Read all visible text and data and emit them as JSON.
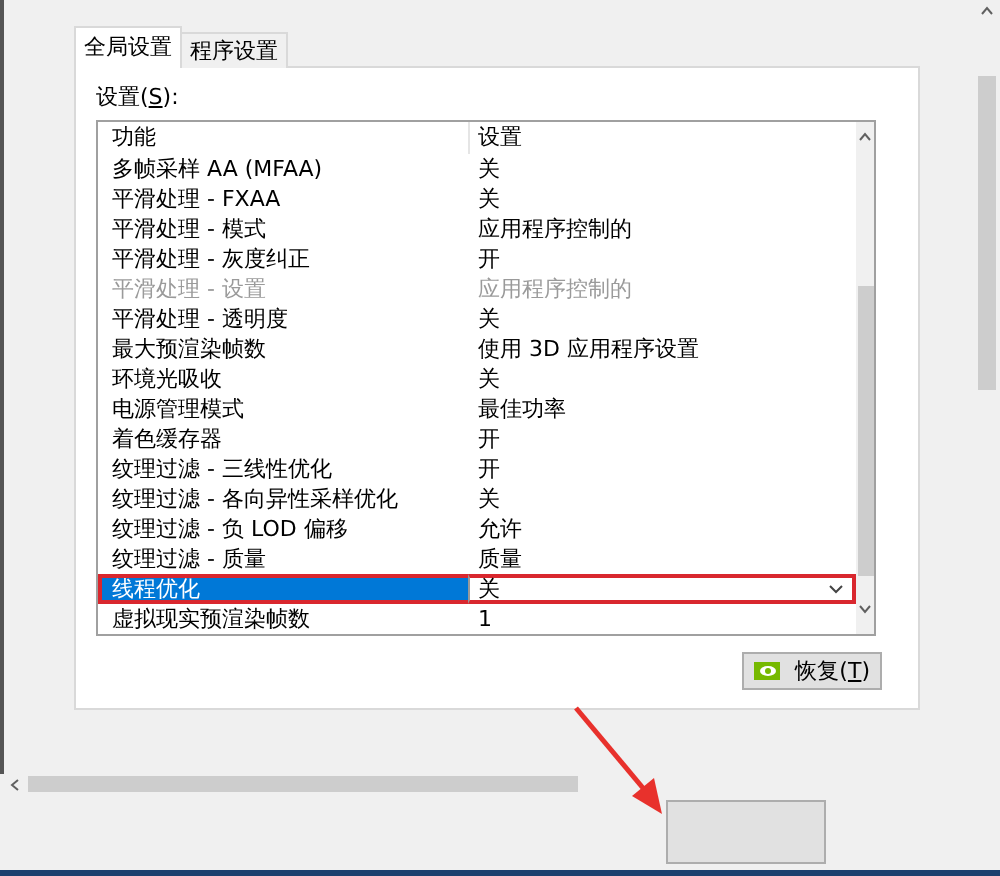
{
  "tabs": [
    {
      "label": "全局设置",
      "selected": true
    },
    {
      "label": "程序设置",
      "selected": false
    }
  ],
  "settings_label": {
    "before": "设置(",
    "mnemonic": "S",
    "after": "):"
  },
  "table": {
    "columns": [
      "功能",
      "设置"
    ],
    "rows": [
      {
        "feature": "多帧采样 AA (MFAA)",
        "value": "关",
        "disabled": false,
        "selected": false,
        "highlighted": false
      },
      {
        "feature": "平滑处理 - FXAA",
        "value": "关",
        "disabled": false,
        "selected": false,
        "highlighted": false
      },
      {
        "feature": "平滑处理 - 模式",
        "value": "应用程序控制的",
        "disabled": false,
        "selected": false,
        "highlighted": false
      },
      {
        "feature": "平滑处理 - 灰度纠正",
        "value": "开",
        "disabled": false,
        "selected": false,
        "highlighted": false
      },
      {
        "feature": "平滑处理 - 设置",
        "value": "应用程序控制的",
        "disabled": true,
        "selected": false,
        "highlighted": false
      },
      {
        "feature": "平滑处理 - 透明度",
        "value": "关",
        "disabled": false,
        "selected": false,
        "highlighted": false
      },
      {
        "feature": "最大预渲染帧数",
        "value": "使用 3D 应用程序设置",
        "disabled": false,
        "selected": false,
        "highlighted": false
      },
      {
        "feature": "环境光吸收",
        "value": "关",
        "disabled": false,
        "selected": false,
        "highlighted": false
      },
      {
        "feature": "电源管理模式",
        "value": "最佳功率",
        "disabled": false,
        "selected": false,
        "highlighted": false
      },
      {
        "feature": "着色缓存器",
        "value": "开",
        "disabled": false,
        "selected": false,
        "highlighted": false
      },
      {
        "feature": "纹理过滤 - 三线性优化",
        "value": "开",
        "disabled": false,
        "selected": false,
        "highlighted": false
      },
      {
        "feature": "纹理过滤 - 各向异性采样优化",
        "value": "关",
        "disabled": false,
        "selected": false,
        "highlighted": false
      },
      {
        "feature": "纹理过滤 - 负 LOD 偏移",
        "value": "允许",
        "disabled": false,
        "selected": false,
        "highlighted": false
      },
      {
        "feature": "纹理过滤 - 质量",
        "value": "质量",
        "disabled": false,
        "selected": false,
        "highlighted": false
      },
      {
        "feature": "线程优化",
        "value": "关",
        "disabled": false,
        "selected": true,
        "highlighted": true
      },
      {
        "feature": "虚拟现实预渲染帧数",
        "value": "1",
        "disabled": false,
        "selected": false,
        "highlighted": false
      }
    ]
  },
  "restore_button": {
    "before": "恢复(",
    "mnemonic": "T",
    "after": ")"
  }
}
